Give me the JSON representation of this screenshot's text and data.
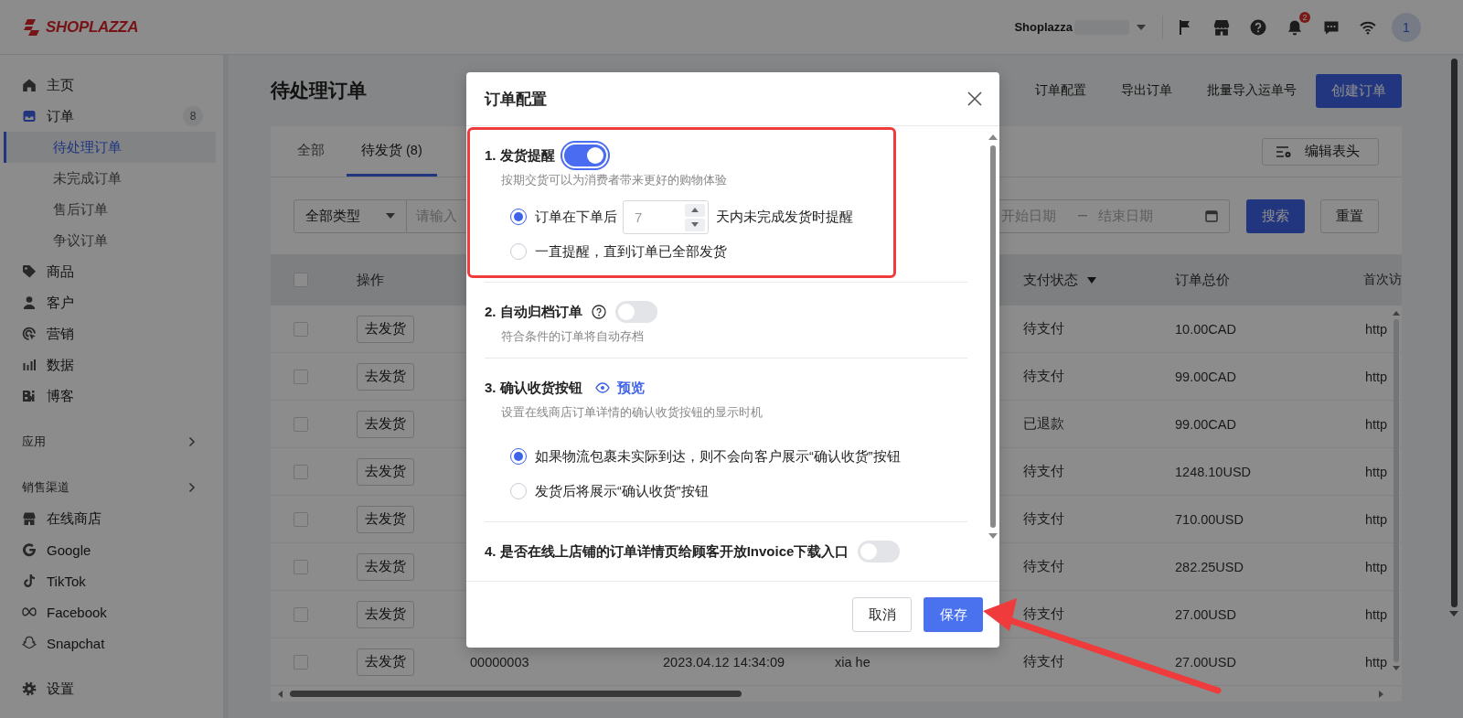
{
  "topbar": {
    "logo": "SHOPLAZZA",
    "store": "Shoplazza",
    "notifications": "2",
    "avatar": "1"
  },
  "sidebar": {
    "nav": [
      {
        "label": "主页",
        "selected": false
      },
      {
        "label": "订单",
        "badge": "8",
        "selected": false,
        "expanded": true,
        "children": [
          {
            "label": "待处理订单",
            "selected": true
          },
          {
            "label": "未完成订单",
            "selected": false
          },
          {
            "label": "售后订单",
            "selected": false
          },
          {
            "label": "争议订单",
            "selected": false
          }
        ]
      },
      {
        "label": "商品",
        "selected": false
      },
      {
        "label": "客户",
        "selected": false
      },
      {
        "label": "营销",
        "selected": false
      },
      {
        "label": "数据",
        "selected": false
      },
      {
        "label": "博客",
        "selected": false
      }
    ],
    "groups": [
      {
        "title": "应用"
      },
      {
        "title": "销售渠道",
        "items": [
          {
            "label": "在线商店",
            "selected": false
          },
          {
            "label": "Google",
            "selected": false
          },
          {
            "label": "TikTok",
            "selected": false
          },
          {
            "label": "Facebook",
            "selected": false
          },
          {
            "label": "Snapchat",
            "selected": false
          }
        ]
      }
    ],
    "settings": {
      "label": "设置",
      "selected": false
    }
  },
  "page": {
    "title": "待处理订单",
    "actions": [
      "订单配置",
      "导出订单",
      "批量导入运单号"
    ],
    "create_button": "创建订单",
    "tabs": [
      {
        "label": "全部",
        "selected": false
      },
      {
        "label": "待发货 (8)",
        "selected": true
      }
    ],
    "edit_columns": "编辑表头",
    "filters": {
      "type": "全部类型",
      "search_placeholder": "请输入",
      "start_placeholder": "开始日期",
      "end_placeholder": "结束日期",
      "search_button": "搜索",
      "reset_button": "重置"
    }
  },
  "table": {
    "header": {
      "checked": false,
      "action": "操作",
      "payment_status": "支付状态",
      "total": "订单总价",
      "column_8": "首次访"
    },
    "rows": [
      {
        "checked": false,
        "action": "去发货",
        "payment_status": "待支付",
        "total": "10.00CAD",
        "column_8": "http"
      },
      {
        "checked": false,
        "action": "去发货",
        "payment_status": "待支付",
        "total": "99.00CAD",
        "column_8": "http"
      },
      {
        "checked": false,
        "action": "去发货",
        "payment_status": "已退款",
        "total": "99.00CAD",
        "column_8": "http"
      },
      {
        "checked": false,
        "action": "去发货",
        "payment_status": "待支付",
        "total": "1248.10USD",
        "column_8": "http"
      },
      {
        "checked": false,
        "action": "去发货",
        "payment_status": "待支付",
        "total": "710.00USD",
        "column_8": "http"
      },
      {
        "checked": false,
        "action": "去发货",
        "payment_status": "待支付",
        "total": "282.25USD",
        "column_8": "http"
      },
      {
        "checked": false,
        "action": "去发货",
        "payment_status": "待支付",
        "total": "27.00USD",
        "column_8": "http"
      },
      {
        "checked": false,
        "action": "去发货",
        "order_no": "00000003",
        "date": "2023.04.12 14:34:09",
        "customer": "xia he",
        "payment_status": "待支付",
        "total": "27.00USD",
        "column_8": "http"
      }
    ]
  },
  "dialog": {
    "title": "订单配置",
    "sections": [
      {
        "kind": "toggle",
        "title": "1. 发货提醒",
        "on": true,
        "focused": true,
        "description": "按期交货可以为消费者带来更好的购物体验",
        "options": [
          {
            "kind": "days",
            "label": "订单在下单后",
            "value": "7",
            "suffix": "天内未完成发货时提醒",
            "selected": true
          },
          {
            "kind": "plain",
            "label": "一直提醒，直到订单已全部发货",
            "selected": false
          }
        ]
      },
      {
        "kind": "toggle-help",
        "title": "2. 自动归档订单",
        "on": false,
        "description": "符合条件的订单将自动存档"
      },
      {
        "kind": "preview",
        "title": "3. 确认收货按钮",
        "link": "预览",
        "description": "设置在线商店订单详情的确认收货按钮的显示时机",
        "options": [
          {
            "kind": "plain",
            "label": "如果物流包裹未实际到达，则不会向客户展示“确认收货”按钮",
            "selected": true
          },
          {
            "kind": "plain",
            "label": "发货后将展示“确认收货”按钮",
            "selected": false
          }
        ]
      },
      {
        "kind": "toggle",
        "title": "4. 是否在线上店铺的订单详情页给顾客开放Invoice下载入口",
        "on": false
      }
    ],
    "cancel": "取消",
    "save": "保存"
  }
}
